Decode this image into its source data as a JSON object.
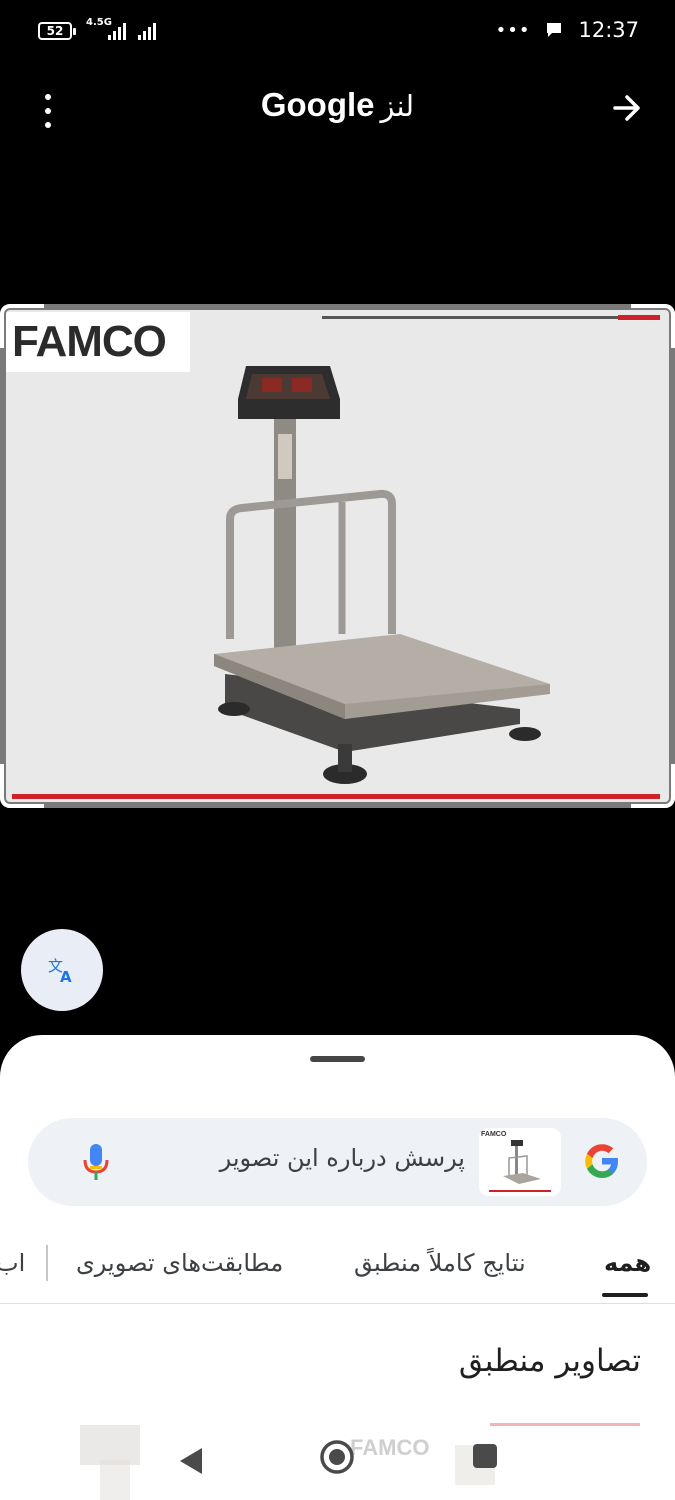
{
  "status_bar": {
    "battery": "52",
    "network": "4.5G",
    "time": "12:37",
    "overflow": "•••"
  },
  "app_bar": {
    "title_brand": "Google",
    "title_suffix": "لنز"
  },
  "image": {
    "logo_text": "FAMCO",
    "accent_color": "#d0202a"
  },
  "sheet": {
    "search_placeholder": "پرسش درباره این تصویر",
    "tabs": [
      {
        "label": "همه",
        "active": true
      },
      {
        "label": "نتایج کاملاً منطبق",
        "active": false
      },
      {
        "label": "مطابقت‌های تصویری",
        "active": false
      },
      {
        "label": "اب",
        "active": false
      }
    ],
    "section_title": "تصاویر منطبق"
  },
  "icons": {
    "menu": "more-vert-icon",
    "forward": "arrow-forward-icon",
    "translate": "translate-icon",
    "mic": "mic-icon",
    "google": "google-g-icon"
  }
}
